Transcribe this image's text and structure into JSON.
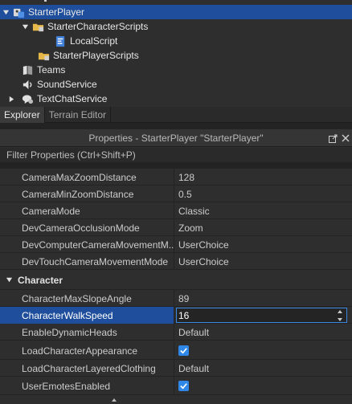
{
  "explorer": {
    "items": [
      {
        "label": "StarterPlayer",
        "icon": "starter-player-icon",
        "expanded": true,
        "selected": true
      },
      {
        "label": "StarterCharacterScripts",
        "icon": "folder-icon",
        "expanded": true
      },
      {
        "label": "LocalScript",
        "icon": "local-script-icon"
      },
      {
        "label": "StarterPlayerScripts",
        "icon": "folder-icon"
      },
      {
        "label": "Teams",
        "icon": "teams-icon"
      },
      {
        "label": "SoundService",
        "icon": "sound-icon"
      },
      {
        "label": "TextChatService",
        "icon": "chat-icon",
        "collapsed": true
      }
    ]
  },
  "tabs": [
    {
      "label": "Explorer",
      "active": true
    },
    {
      "label": "Terrain Editor",
      "active": false
    }
  ],
  "properties": {
    "title": "Properties - StarterPlayer \"StarterPlayer\"",
    "filter_placeholder": "Filter Properties (Ctrl+Shift+P)",
    "rows": [
      {
        "name": "CameraMaxZoomDistance",
        "value": "128"
      },
      {
        "name": "CameraMinZoomDistance",
        "value": "0.5"
      },
      {
        "name": "CameraMode",
        "value": "Classic"
      },
      {
        "name": "DevCameraOcclusionMode",
        "value": "Zoom"
      },
      {
        "name": "DevComputerCameraMovementM...",
        "value": "UserChoice"
      },
      {
        "name": "DevTouchCameraMovementMode",
        "value": "UserChoice"
      }
    ],
    "section": "Character",
    "character_rows": [
      {
        "name": "CharacterMaxSlopeAngle",
        "value": "89"
      },
      {
        "name": "CharacterWalkSpeed",
        "value": "16",
        "editing": true
      },
      {
        "name": "EnableDynamicHeads",
        "value": "Default"
      },
      {
        "name": "LoadCharacterAppearance",
        "checked": true
      },
      {
        "name": "LoadCharacterLayeredClothing",
        "value": "Default"
      },
      {
        "name": "UserEmotesEnabled",
        "checked": true
      }
    ]
  },
  "colors": {
    "selection": "#1f4f9c",
    "checkbox": "#2f88e8",
    "panel": "#2e2e2e"
  }
}
